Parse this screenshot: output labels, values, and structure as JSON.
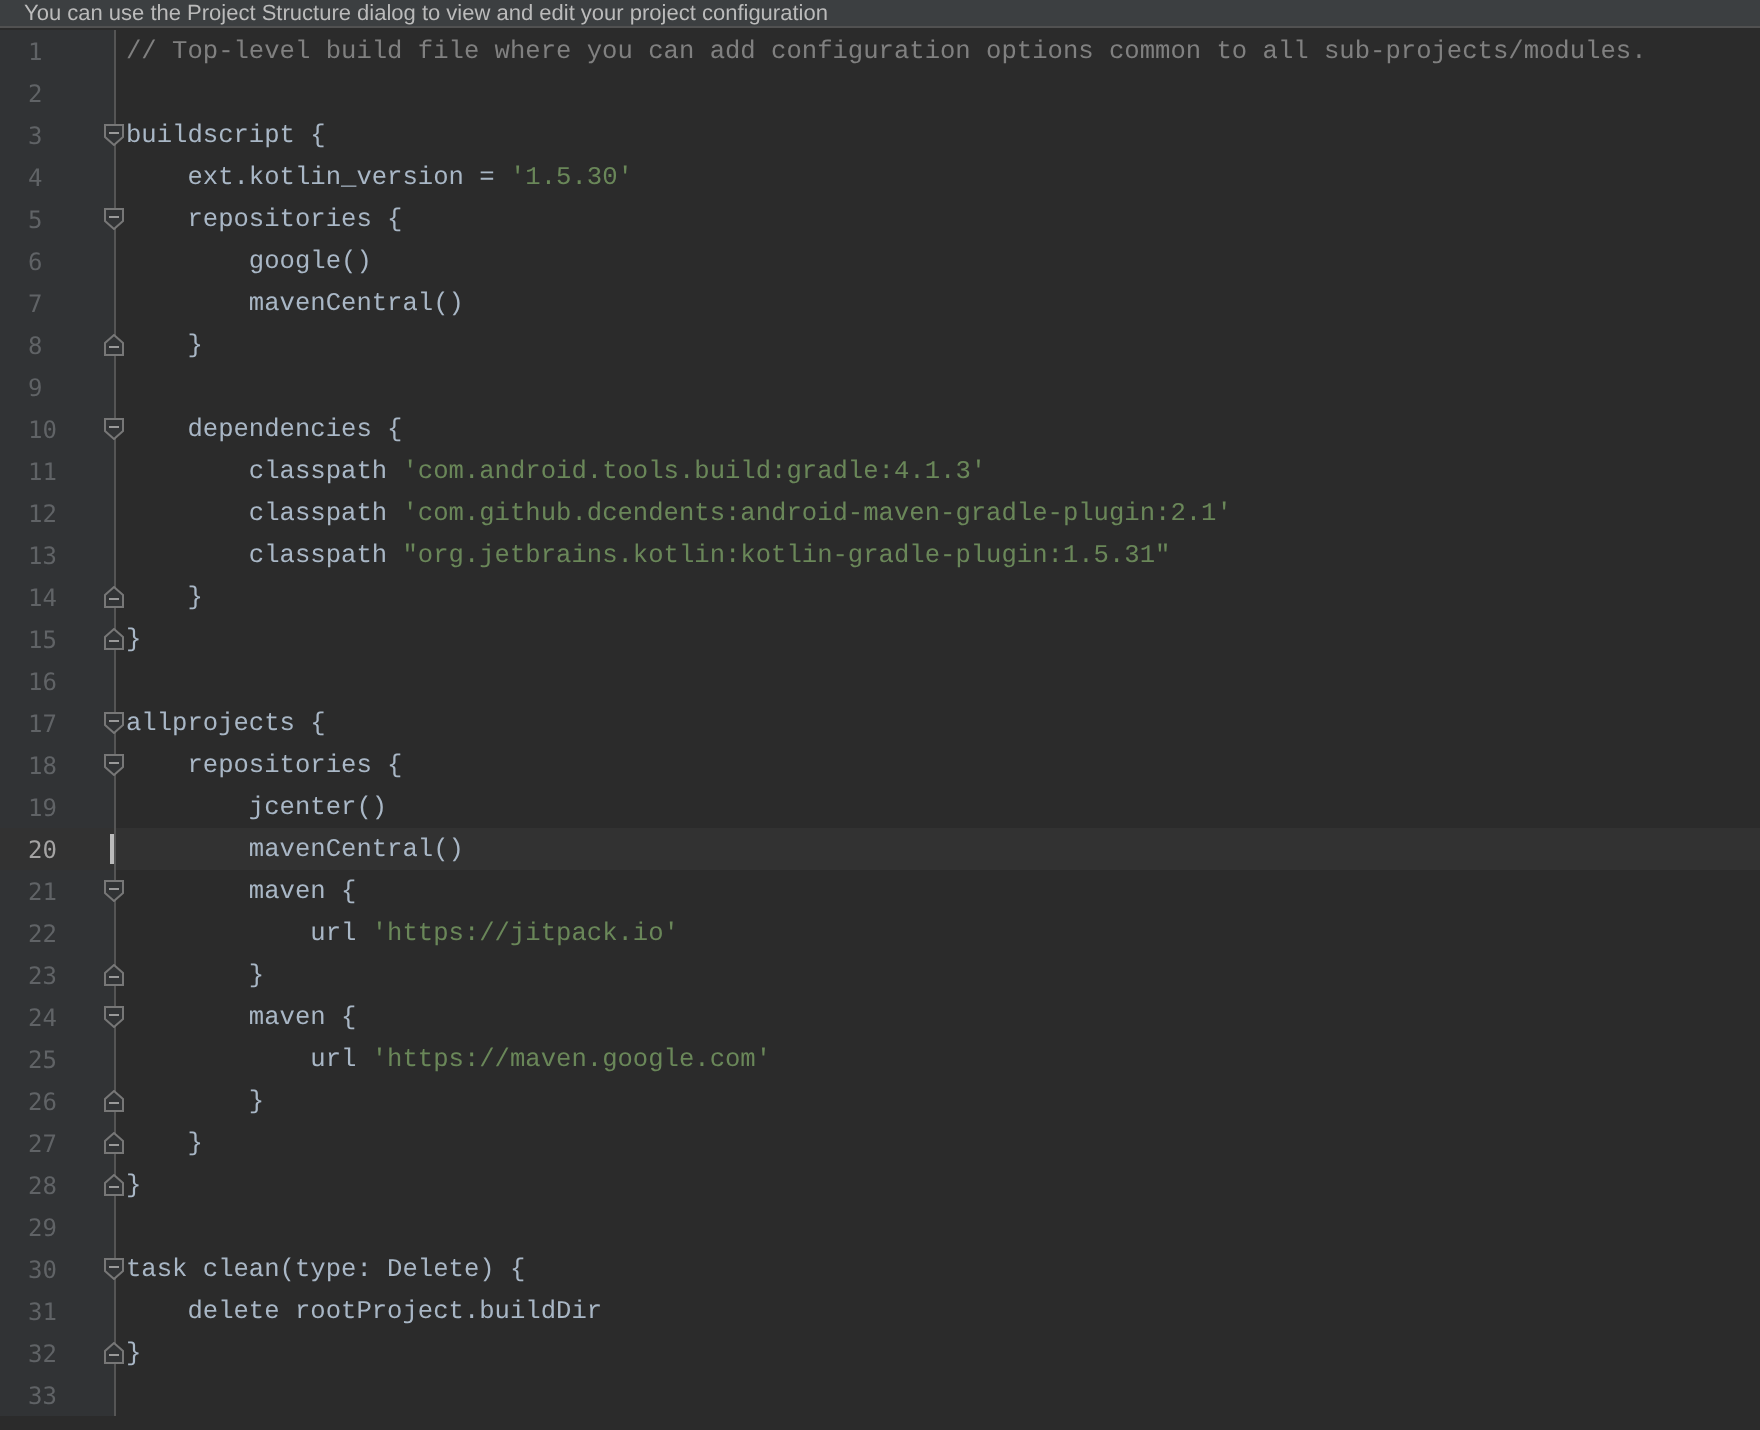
{
  "banner": {
    "text": "You can use the Project Structure dialog to view and edit your project configuration"
  },
  "editor": {
    "lines": [
      {
        "number": "1",
        "fold_start": false,
        "fold_end": false,
        "current": false,
        "tokens": [
          {
            "kind": "comment",
            "text": "// Top-level build file where you can add configuration options common to all sub-projects/modules."
          }
        ]
      },
      {
        "number": "2",
        "fold_start": false,
        "fold_end": false,
        "current": false
      },
      {
        "number": "3",
        "fold_start": true,
        "fold_end": false,
        "current": false,
        "tokens": [
          {
            "kind": "plain",
            "text": "buildscript {"
          }
        ]
      },
      {
        "number": "4",
        "fold_start": false,
        "fold_end": false,
        "current": false,
        "tokens": [
          {
            "kind": "plain",
            "text": "    ext.kotlin_version = "
          },
          {
            "kind": "string",
            "text": "'1.5.30'"
          }
        ]
      },
      {
        "number": "5",
        "fold_start": true,
        "fold_end": false,
        "current": false,
        "tokens": [
          {
            "kind": "plain",
            "text": "    repositories {"
          }
        ]
      },
      {
        "number": "6",
        "fold_start": false,
        "fold_end": false,
        "current": false,
        "tokens": [
          {
            "kind": "plain",
            "text": "        google()"
          }
        ]
      },
      {
        "number": "7",
        "fold_start": false,
        "fold_end": false,
        "current": false,
        "tokens": [
          {
            "kind": "plain",
            "text": "        mavenCentral()"
          }
        ]
      },
      {
        "number": "8",
        "fold_start": false,
        "fold_end": true,
        "current": false,
        "tokens": [
          {
            "kind": "plain",
            "text": "    }"
          }
        ]
      },
      {
        "number": "9",
        "fold_start": false,
        "fold_end": false,
        "current": false
      },
      {
        "number": "10",
        "fold_start": true,
        "fold_end": false,
        "current": false,
        "tokens": [
          {
            "kind": "plain",
            "text": "    dependencies {"
          }
        ]
      },
      {
        "number": "11",
        "fold_start": false,
        "fold_end": false,
        "current": false,
        "tokens": [
          {
            "kind": "plain",
            "text": "        classpath "
          },
          {
            "kind": "string",
            "text": "'com.android.tools.build:gradle:4.1.3'"
          }
        ]
      },
      {
        "number": "12",
        "fold_start": false,
        "fold_end": false,
        "current": false,
        "tokens": [
          {
            "kind": "plain",
            "text": "        classpath "
          },
          {
            "kind": "string",
            "text": "'com.github.dcendents:android-maven-gradle-plugin:2.1'"
          }
        ]
      },
      {
        "number": "13",
        "fold_start": false,
        "fold_end": false,
        "current": false,
        "tokens": [
          {
            "kind": "plain",
            "text": "        classpath "
          },
          {
            "kind": "string",
            "text": "\"org.jetbrains.kotlin:kotlin-gradle-plugin:1.5.31\""
          }
        ]
      },
      {
        "number": "14",
        "fold_start": false,
        "fold_end": true,
        "current": false,
        "tokens": [
          {
            "kind": "plain",
            "text": "    }"
          }
        ]
      },
      {
        "number": "15",
        "fold_start": false,
        "fold_end": true,
        "current": false,
        "tokens": [
          {
            "kind": "plain",
            "text": "}"
          }
        ]
      },
      {
        "number": "16",
        "fold_start": false,
        "fold_end": false,
        "current": false
      },
      {
        "number": "17",
        "fold_start": true,
        "fold_end": false,
        "current": false,
        "tokens": [
          {
            "kind": "plain",
            "text": "allprojects {"
          }
        ]
      },
      {
        "number": "18",
        "fold_start": true,
        "fold_end": false,
        "current": false,
        "tokens": [
          {
            "kind": "plain",
            "text": "    repositories {"
          }
        ]
      },
      {
        "number": "19",
        "fold_start": false,
        "fold_end": false,
        "current": false,
        "tokens": [
          {
            "kind": "plain",
            "text": "        jcenter()"
          }
        ]
      },
      {
        "number": "20",
        "fold_start": false,
        "fold_end": false,
        "current": true,
        "tokens": [
          {
            "kind": "plain",
            "text": "        mavenCentral()"
          }
        ]
      },
      {
        "number": "21",
        "fold_start": true,
        "fold_end": false,
        "current": false,
        "tokens": [
          {
            "kind": "plain",
            "text": "        maven {"
          }
        ]
      },
      {
        "number": "22",
        "fold_start": false,
        "fold_end": false,
        "current": false,
        "tokens": [
          {
            "kind": "plain",
            "text": "            url "
          },
          {
            "kind": "string",
            "text": "'https://jitpack.io'"
          }
        ]
      },
      {
        "number": "23",
        "fold_start": false,
        "fold_end": true,
        "current": false,
        "tokens": [
          {
            "kind": "plain",
            "text": "        }"
          }
        ]
      },
      {
        "number": "24",
        "fold_start": true,
        "fold_end": false,
        "current": false,
        "tokens": [
          {
            "kind": "plain",
            "text": "        maven {"
          }
        ]
      },
      {
        "number": "25",
        "fold_start": false,
        "fold_end": false,
        "current": false,
        "tokens": [
          {
            "kind": "plain",
            "text": "            url "
          },
          {
            "kind": "string",
            "text": "'https://maven.google.com'"
          }
        ]
      },
      {
        "number": "26",
        "fold_start": false,
        "fold_end": true,
        "current": false,
        "tokens": [
          {
            "kind": "plain",
            "text": "        }"
          }
        ]
      },
      {
        "number": "27",
        "fold_start": false,
        "fold_end": true,
        "current": false,
        "tokens": [
          {
            "kind": "plain",
            "text": "    }"
          }
        ]
      },
      {
        "number": "28",
        "fold_start": false,
        "fold_end": true,
        "current": false,
        "tokens": [
          {
            "kind": "plain",
            "text": "}"
          }
        ]
      },
      {
        "number": "29",
        "fold_start": false,
        "fold_end": false,
        "current": false
      },
      {
        "number": "30",
        "fold_start": true,
        "fold_end": false,
        "current": false,
        "tokens": [
          {
            "kind": "plain",
            "text": "task clean(type: Delete) {"
          }
        ]
      },
      {
        "number": "31",
        "fold_start": false,
        "fold_end": false,
        "current": false,
        "tokens": [
          {
            "kind": "plain",
            "text": "    delete rootProject.buildDir"
          }
        ]
      },
      {
        "number": "32",
        "fold_start": false,
        "fold_end": true,
        "current": false,
        "tokens": [
          {
            "kind": "plain",
            "text": "}"
          }
        ]
      },
      {
        "number": "33",
        "fold_start": false,
        "fold_end": false,
        "current": false
      }
    ]
  }
}
